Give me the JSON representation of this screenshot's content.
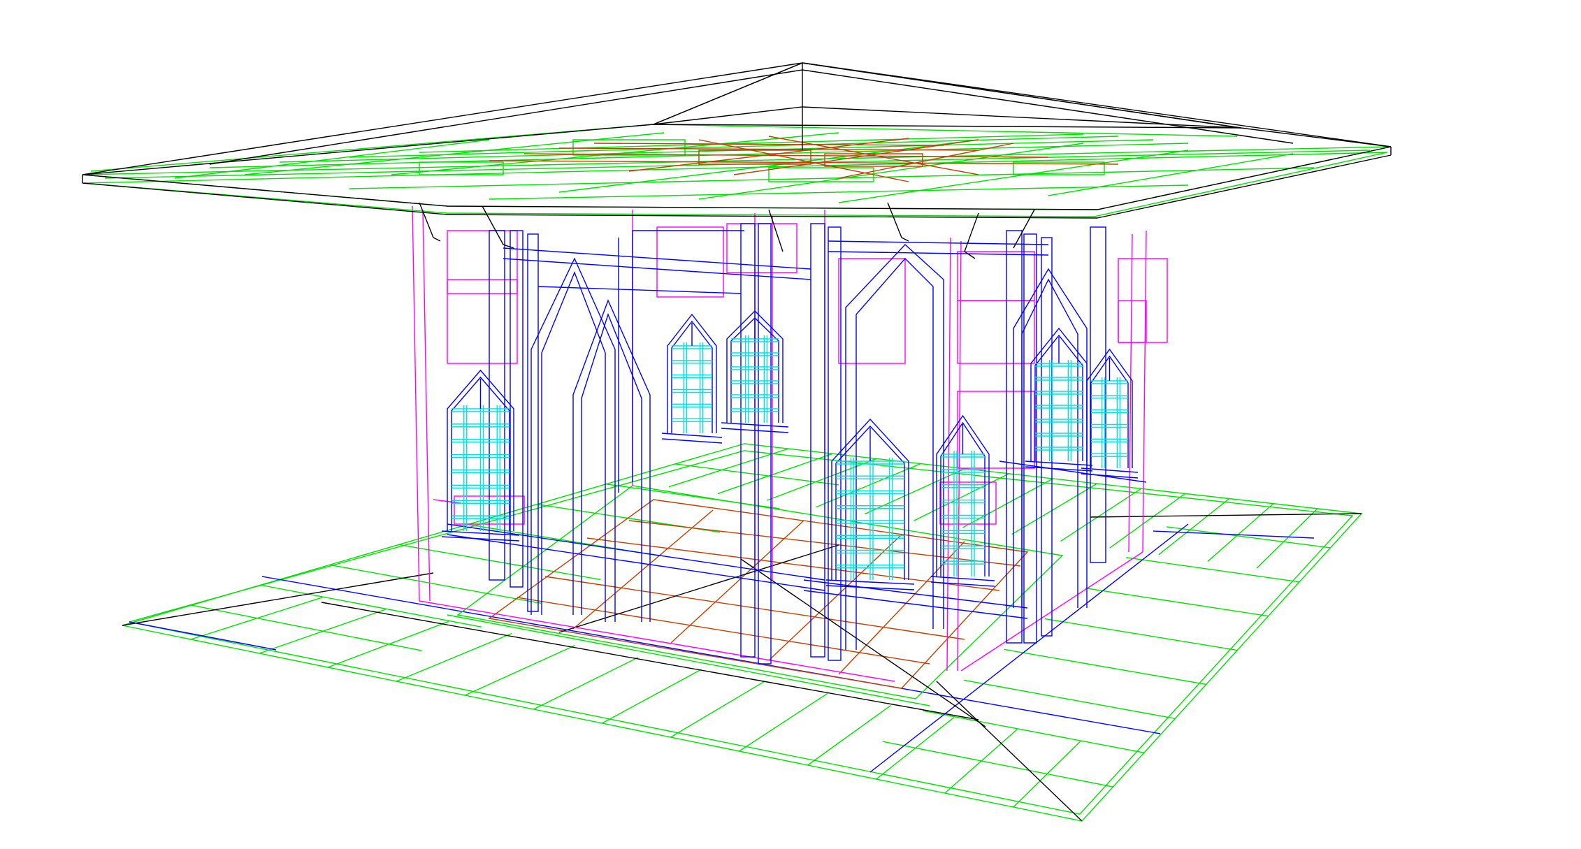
{
  "viewport": {
    "background": "#ffffff",
    "projection": "perspective",
    "style": "wireframe"
  },
  "layers": [
    {
      "name": "roof-outline",
      "color": "#000000"
    },
    {
      "name": "roof-structure",
      "color": "#00e000"
    },
    {
      "name": "ceiling-beams",
      "color": "#c04000"
    },
    {
      "name": "walls",
      "color": "#ff00ff"
    },
    {
      "name": "columns-and-frames",
      "color": "#0000ff"
    },
    {
      "name": "window-glazing",
      "color": "#00e0e0"
    },
    {
      "name": "ground-grid",
      "color": "#00e000"
    },
    {
      "name": "floor-grid",
      "color": "#c04000"
    }
  ],
  "model": {
    "subject": "pavilion",
    "features": [
      "hipped-roof",
      "gothic-arched-windows",
      "paved-plinth"
    ]
  }
}
